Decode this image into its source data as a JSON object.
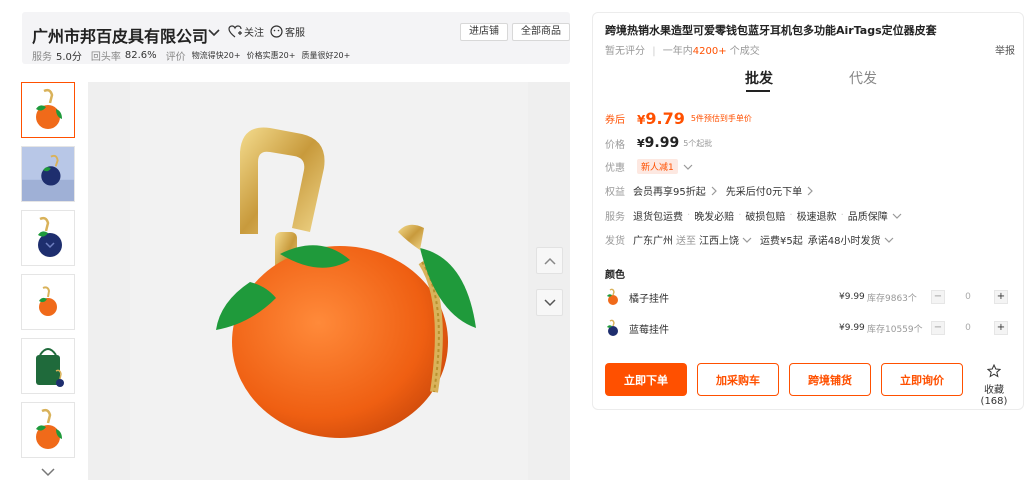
{
  "shop": {
    "name": "广州市邦百皮具有限公司",
    "follow_label": "关注",
    "service_label": "客服",
    "enter_store_label": "进店铺",
    "all_products_label": "全部商品",
    "stats": {
      "service_label": "服务",
      "service_value": "5.0分",
      "repurchase_label": "回头率",
      "repurchase_value": "82.6%",
      "rating_label": "评价",
      "tags": [
        "物流得快20+",
        "价格实惠20+",
        "质量很好20+"
      ]
    }
  },
  "gallery": {
    "thumbnails": [
      "orange-keychain",
      "blue-keychain-scene",
      "blueberry-keychain",
      "orange-keychain-small",
      "green-bag-with-keychain",
      "orange-keychain-detail"
    ]
  },
  "product": {
    "title": "跨境热销水果造型可爱零钱包蓝牙耳机包多功能AirTags定位器皮套",
    "rating": "暂无评分",
    "sales_prefix": "一年内",
    "sales_count": "4200+",
    "sales_suffix": "个成交",
    "report_label": "举报",
    "tabs": [
      "批发",
      "代发"
    ],
    "promo_label": "券后",
    "promo_currency": "¥",
    "promo_price": "9.79",
    "promo_note": "5件预估到手单价",
    "price_label": "价格",
    "price_currency": "¥",
    "price_value": "9.99",
    "min_order": "5个起批",
    "discount_label": "优惠",
    "discount_badge": "新人减1",
    "rights_label": "权益",
    "rights_items": [
      "会员再享95折起",
      "先采后付0元下单"
    ],
    "service_label": "服务",
    "service_items": [
      "退货包运费",
      "晚发必赔",
      "破损包赔",
      "极速退款",
      "品质保障"
    ],
    "ship_label": "发货",
    "ship_from": "广东广州",
    "ship_to_prefix": "送至",
    "ship_to": "江西上饶",
    "shipping_fee": "运费¥5起",
    "ship_promise": "承诺48小时发货",
    "color_label": "颜色",
    "skus": [
      {
        "name": "橘子挂件",
        "price": "¥9.99",
        "stock": "库存9863个",
        "qty": "0"
      },
      {
        "name": "蓝莓挂件",
        "price": "¥9.99",
        "stock": "库存10559个",
        "qty": "0"
      }
    ],
    "actions": {
      "buy_now": "立即下单",
      "add_cart": "加采购车",
      "cross_border": "跨境铺货",
      "inquiry": "立即询价",
      "favorite": "收藏",
      "favorite_count": "(168)"
    }
  },
  "colors": {
    "accent": "#ff5000",
    "orange_fruit": "#f06a1a",
    "leaf": "#1f9a3b",
    "gold": "#d9b25a",
    "blueberry": "#1e2e6e"
  }
}
